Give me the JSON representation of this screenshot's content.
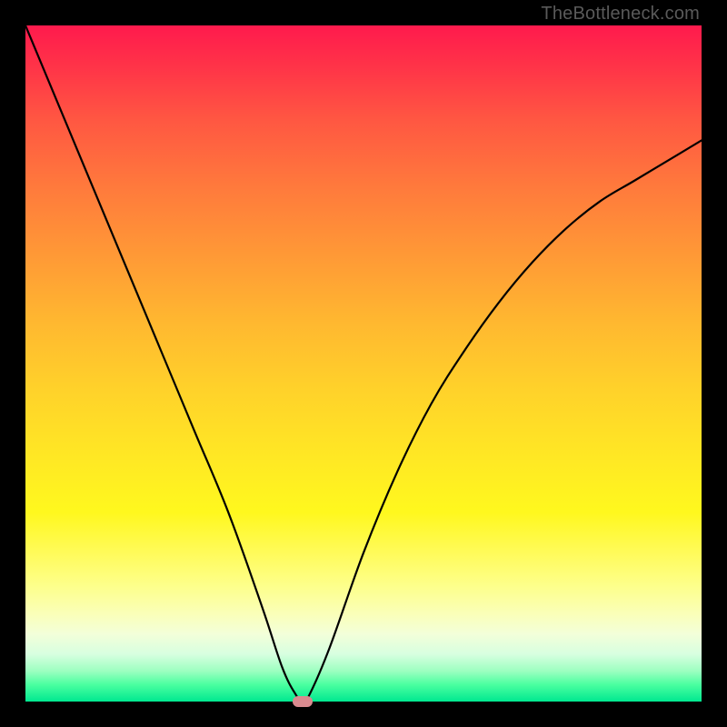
{
  "watermark": "TheBottleneck.com",
  "colors": {
    "frame": "#000000",
    "gradient_top": "#ff1a4d",
    "gradient_bottom": "#00e890",
    "curve": "#000000",
    "marker": "#d98a8f"
  },
  "chart_data": {
    "type": "line",
    "title": "",
    "xlabel": "",
    "ylabel": "",
    "xlim": [
      0,
      100
    ],
    "ylim": [
      0,
      100
    ],
    "grid": false,
    "legend": false,
    "annotations": [
      "TheBottleneck.com"
    ],
    "series": [
      {
        "name": "bottleneck-curve",
        "x": [
          0,
          5,
          10,
          15,
          20,
          25,
          30,
          35,
          38,
          40,
          41,
          42,
          45,
          50,
          55,
          60,
          65,
          70,
          75,
          80,
          85,
          90,
          95,
          100
        ],
        "y": [
          100,
          88,
          76,
          64,
          52,
          40,
          28,
          14,
          5,
          1,
          0,
          1,
          8,
          22,
          34,
          44,
          52,
          59,
          65,
          70,
          74,
          77,
          80,
          83
        ]
      }
    ],
    "marker": {
      "x": 41,
      "y": 0
    },
    "semantics": "V-shaped bottleneck indicator on rainbow gradient; minimum near x≈41 indicates optimal match; red=high bottleneck, green=low bottleneck"
  }
}
